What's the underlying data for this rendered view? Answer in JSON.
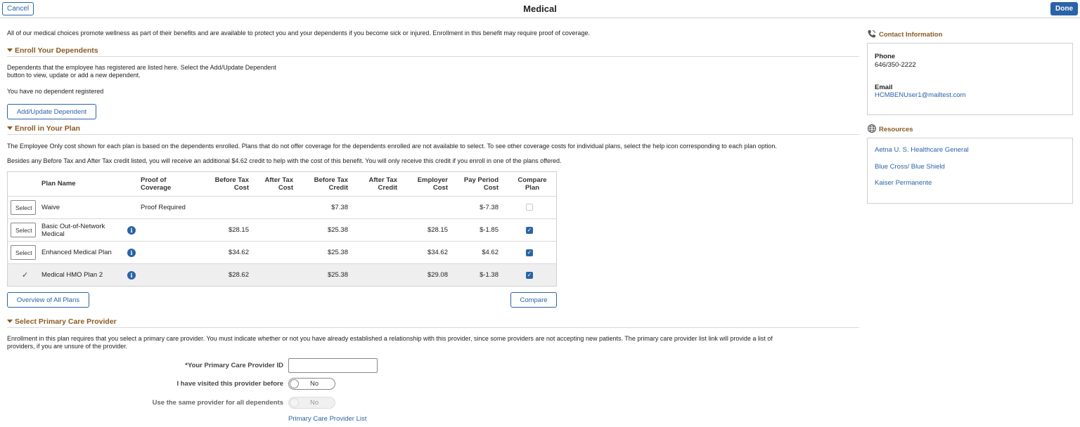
{
  "header": {
    "cancel_label": "Cancel",
    "title": "Medical",
    "done_label": "Done"
  },
  "intro": "All of our medical choices promote wellness as part of their benefits and are available to protect you and your dependents if you become sick or injured. Enrollment in this benefit may require proof of coverage.",
  "dependents": {
    "heading": "Enroll Your Dependents",
    "description_line1": "Dependents that the employee has registered are listed here. Select the Add/Update Dependent",
    "description_line2": "button to view, update or add a new dependent.",
    "none_text": "You have no dependent registered",
    "add_button": "Add/Update Dependent"
  },
  "plan": {
    "heading": "Enroll in Your Plan",
    "note1": "The Employee Only cost shown for each plan is based on the dependents enrolled. Plans that do not offer coverage for the dependents enrolled are not available to select. To see other coverage costs for individual plans, select the help icon corresponding to each plan option.",
    "note2": "Besides any Before Tax and After Tax credit listed, you will receive an additional $4.62 credit to help with the cost of this benefit.  You will only receive this credit if you enroll in one of the plans offered.",
    "columns": {
      "plan_name": "Plan Name",
      "proof_1": "Proof of",
      "proof_2": "Coverage",
      "btc_1": "Before Tax",
      "btc_2": "Cost",
      "atc_1": "After Tax",
      "atc_2": "Cost",
      "btcr_1": "Before Tax",
      "btcr_2": "Credit",
      "atcr_1": "After Tax",
      "atcr_2": "Credit",
      "emp_1": "Employer",
      "emp_2": "Cost",
      "pp_1": "Pay Period",
      "pp_2": "Cost",
      "cmp_1": "Compare",
      "cmp_2": "Plan"
    },
    "select_label": "Select",
    "selected_mark": "✓",
    "rows": [
      {
        "name_1": "Waive",
        "name_2": "",
        "proof": "Proof Required",
        "before_tax_cost": "",
        "after_tax_cost": "",
        "before_tax_credit": "$7.38",
        "after_tax_credit": "",
        "employer_cost": "",
        "pay_period_cost": "$-7.38",
        "compare": false,
        "selected": false
      },
      {
        "name_1": "Basic Out-of-Network",
        "name_2": "Medical",
        "proof": "",
        "before_tax_cost": "$28.15",
        "after_tax_cost": "",
        "before_tax_credit": "$25.38",
        "after_tax_credit": "",
        "employer_cost": "$28.15",
        "pay_period_cost": "$-1.85",
        "compare": true,
        "selected": false
      },
      {
        "name_1": "Enhanced Medical Plan",
        "name_2": "",
        "proof": "",
        "before_tax_cost": "$34.62",
        "after_tax_cost": "",
        "before_tax_credit": "$25.38",
        "after_tax_credit": "",
        "employer_cost": "$34.62",
        "pay_period_cost": "$4.62",
        "compare": true,
        "selected": false
      },
      {
        "name_1": "Medical HMO Plan 2",
        "name_2": "",
        "proof": "",
        "before_tax_cost": "$28.62",
        "after_tax_cost": "",
        "before_tax_credit": "$25.38",
        "after_tax_credit": "",
        "employer_cost": "$29.08",
        "pay_period_cost": "$-1.38",
        "compare": true,
        "selected": true
      }
    ],
    "overview_button": "Overview of All Plans",
    "compare_button": "Compare"
  },
  "pcp": {
    "heading": "Select Primary Care Provider",
    "note_line1": "Enrollment in this plan requires that you select a primary care provider. You must indicate whether or not you have already established a relationship with this provider, since some providers are not accepting new patients. The primary care provider list link will provide a list of",
    "note_line2": "providers, if you are unsure of the provider.",
    "id_label": "*Your Primary Care Provider ID",
    "id_value": "",
    "visited_label": "I have visited this provider before",
    "visited_value": "No",
    "same_label": "Use the same provider for all dependents",
    "same_value": "No",
    "list_link": "Primary Care Provider List"
  },
  "contact": {
    "heading": "Contact Information",
    "phone_label": "Phone",
    "phone_value": "646/350-2222",
    "email_label": "Email",
    "email_value": "HCMBENUser1@mailtest.com"
  },
  "resources": {
    "heading": "Resources",
    "links": [
      "Aetna U. S. Healthcare General",
      "Blue Cross/ Blue Shield",
      "Kaiser Permanente"
    ]
  },
  "colors": {
    "accent": "#2a63a8",
    "section_heading": "#8a5a22"
  }
}
